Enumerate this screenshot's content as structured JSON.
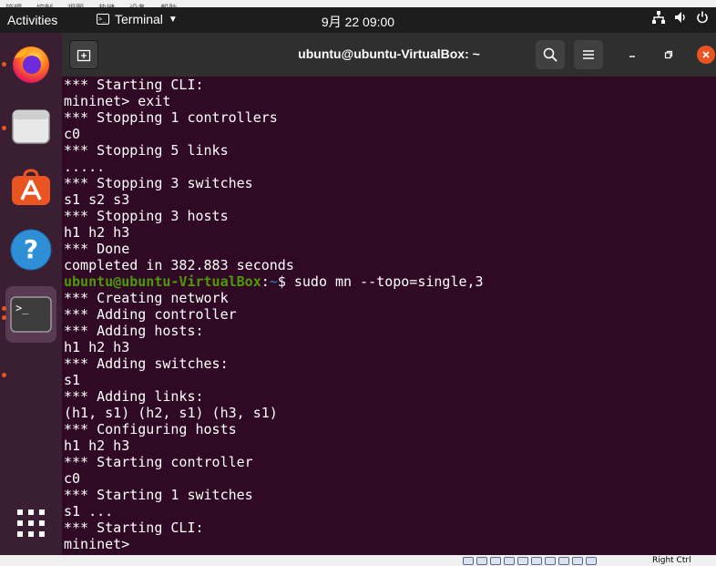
{
  "host_menu": [
    "管理",
    "控制",
    "视图",
    "热键",
    "设备",
    "帮助"
  ],
  "topbar": {
    "activities": "Activities",
    "app_name": "Terminal",
    "clock": "9月 22  09:00",
    "icons": [
      "network-icon",
      "volume-icon",
      "power-icon"
    ]
  },
  "dock": {
    "apps": [
      "firefox-icon",
      "files-icon",
      "software-icon",
      "help-icon",
      "terminal-icon",
      "show-apps-icon"
    ]
  },
  "window": {
    "title": "ubuntu@ubuntu-VirtualBox: ~"
  },
  "terminal": {
    "lines": [
      "*** Starting CLI:",
      "mininet> exit",
      "*** Stopping 1 controllers",
      "c0",
      "*** Stopping 5 links",
      ".....",
      "*** Stopping 3 switches",
      "s1 s2 s3",
      "*** Stopping 3 hosts",
      "h1 h2 h3",
      "*** Done",
      "completed in 382.883 seconds"
    ],
    "prompt": {
      "userhost": "ubuntu@ubuntu-VirtualBox",
      "colon": ":",
      "path": "~",
      "symbol": "$",
      "command": " sudo mn --topo=single,3"
    },
    "lines_after": [
      "*** Creating network",
      "*** Adding controller",
      "*** Adding hosts:",
      "h1 h2 h3",
      "*** Adding switches:",
      "s1",
      "*** Adding links:",
      "(h1, s1) (h2, s1) (h3, s1)",
      "*** Configuring hosts",
      "h1 h2 h3",
      "*** Starting controller",
      "c0",
      "*** Starting 1 switches",
      "s1 ...",
      "*** Starting CLI:",
      "mininet>"
    ]
  },
  "statusbar": {
    "right_ctrl": "Right Ctrl"
  }
}
